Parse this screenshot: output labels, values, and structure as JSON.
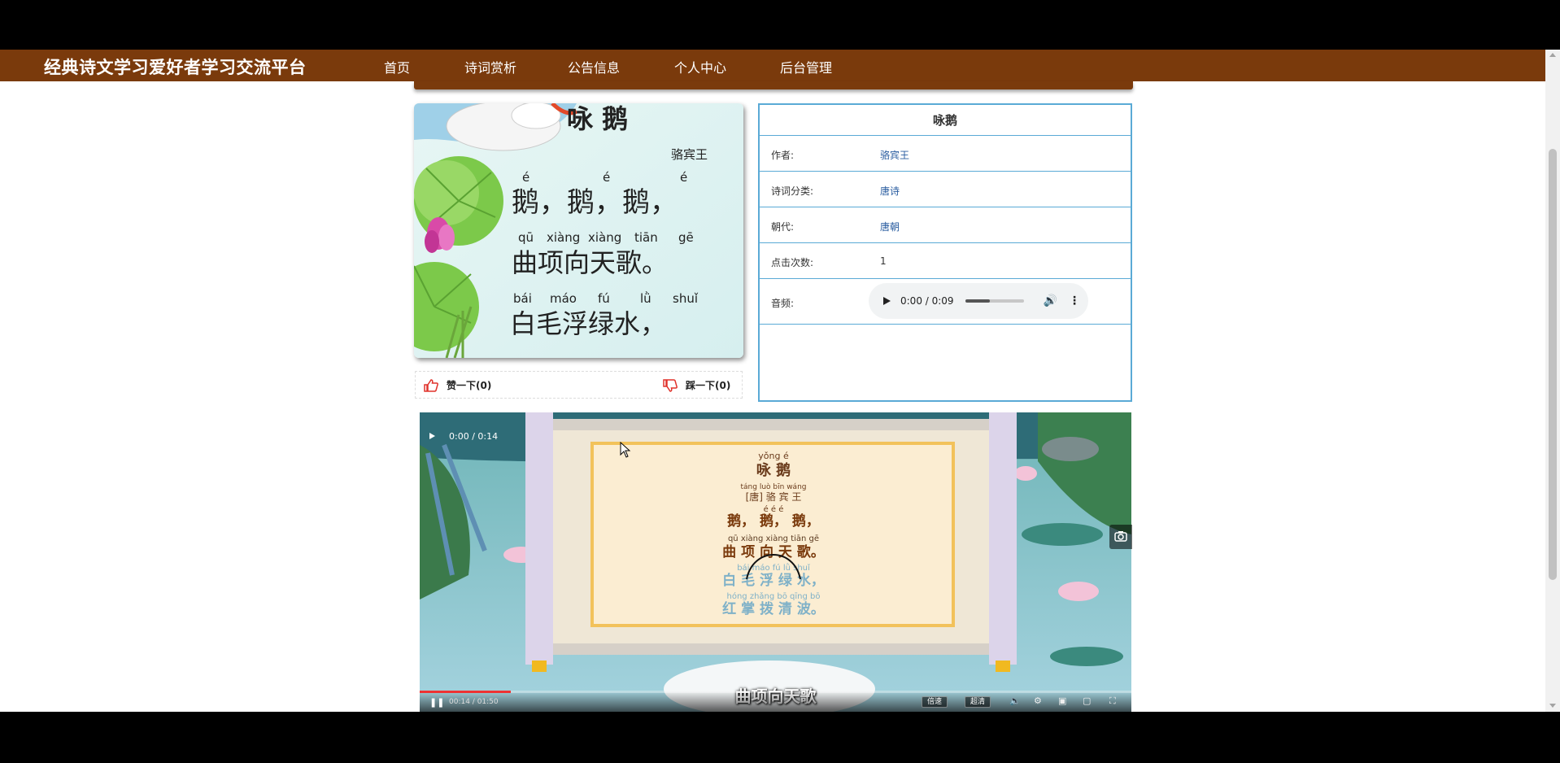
{
  "app": {
    "brand": "经典诗文学习爱好者学习交流平台",
    "nav": [
      {
        "label": "首页"
      },
      {
        "label": "诗词赏析"
      },
      {
        "label": "公告信息"
      },
      {
        "label": "个人中心"
      },
      {
        "label": "后台管理"
      }
    ],
    "colors": {
      "nav_bg": "#7a3a0c",
      "panel_border": "#5aaad6",
      "link": "#2a5da0",
      "vote_icon": "#e0322b"
    }
  },
  "poem_image": {
    "title": "咏 鹅",
    "author": "骆宾王",
    "lines": [
      {
        "pinyin": [
          "é",
          "é",
          "é"
        ],
        "text": "鹅，鹅，鹅，"
      },
      {
        "pinyin": [
          "qū",
          "xiàng",
          "xiàng",
          "tiān",
          "gē"
        ],
        "text": "曲项向天歌。"
      },
      {
        "pinyin": [
          "bái",
          "máo",
          "fú",
          "lǜ",
          "shuǐ"
        ],
        "text": "白毛浮绿水，"
      }
    ]
  },
  "votes": {
    "like_label": "赞一下(0)",
    "dislike_label": "踩一下(0)",
    "like_icon": "thumbs-up-icon",
    "dislike_icon": "thumbs-down-icon"
  },
  "info": {
    "title": "咏鹅",
    "rows": {
      "author": {
        "label": "作者:",
        "value": "骆宾王"
      },
      "category": {
        "label": "诗词分类:",
        "value": "唐诗"
      },
      "dynasty": {
        "label": "朝代:",
        "value": "唐朝"
      },
      "clicks": {
        "label": "点击次数:",
        "value": "1"
      },
      "audio": {
        "label": "音频:",
        "time": "0:00 / 0:09"
      }
    }
  },
  "video": {
    "scroll": {
      "title_pinyin": "yǒng    é",
      "title": "咏  鹅",
      "author_pinyin": "táng  luò bīn wáng",
      "author": "[唐] 骆 宾 王",
      "lines": [
        {
          "pinyin": "é       é       é",
          "text": "鹅， 鹅， 鹅，"
        },
        {
          "pinyin": "qū   xiàng  xiàng  tiān   gē",
          "text": "曲  项  向  天  歌。"
        },
        {
          "pinyin": "bái   máo    fú    lǜ    shuǐ",
          "text": "白  毛  浮  绿  水，"
        },
        {
          "pinyin": "hóng  zhǎng  bō   qīng   bō",
          "text": "红  掌  拨  清  波。"
        }
      ]
    },
    "subtitle": "曲项向天歌",
    "inner_time": "00:14 / 01:50",
    "speed_label": "倍速",
    "quality_label": "超清",
    "time": "0:00 / 0:14"
  }
}
